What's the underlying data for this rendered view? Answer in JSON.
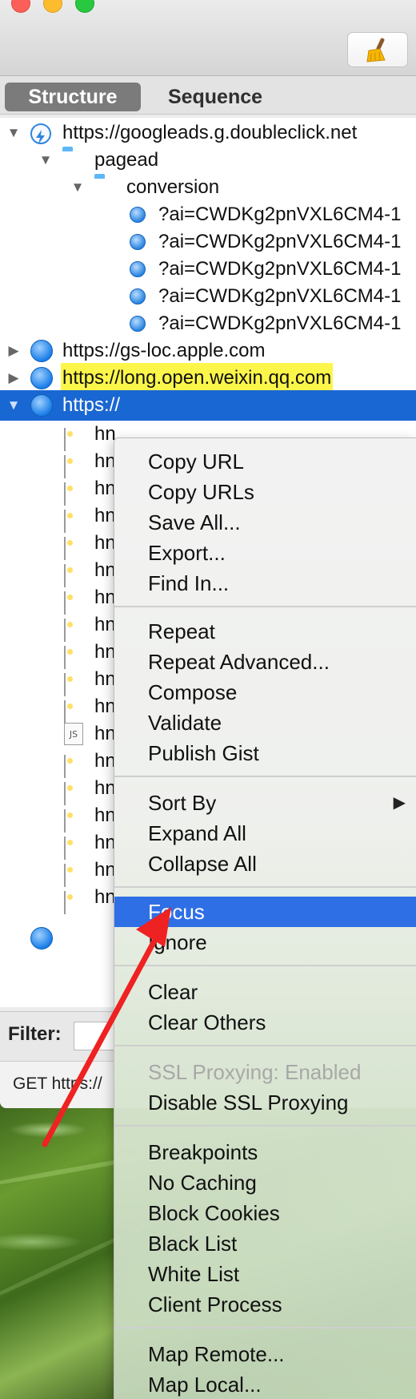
{
  "toolbar": {
    "clear_icon": "broom-icon"
  },
  "tabs": [
    {
      "label": "Structure",
      "active": true
    },
    {
      "label": "Sequence",
      "active": false
    }
  ],
  "tree": {
    "host1": "https://googleads.g.doubleclick.net",
    "folder1": "pagead",
    "folder2": "conversion",
    "requests": [
      "?ai=CWDKg2pnVXL6CM4-1",
      "?ai=CWDKg2pnVXL6CM4-1",
      "?ai=CWDKg2pnVXL6CM4-1",
      "?ai=CWDKg2pnVXL6CM4-1",
      "?ai=CWDKg2pnVXL6CM4-1"
    ],
    "host2": "https://gs-loc.apple.com",
    "host3": "https://long.open.weixin.qq.com",
    "host4_partial": "https://",
    "child_prefix": "hn"
  },
  "filter": {
    "label": "Filter:"
  },
  "status": {
    "text": "GET https://"
  },
  "context_menu": {
    "group1": [
      "Copy URL",
      "Copy URLs",
      "Save All...",
      "Export...",
      "Find In..."
    ],
    "group2": [
      "Repeat",
      "Repeat Advanced...",
      "Compose",
      "Validate",
      "Publish Gist"
    ],
    "group3": [
      "Sort By",
      "Expand All",
      "Collapse All"
    ],
    "group4": [
      "Focus",
      "Ignore"
    ],
    "group5": [
      "Clear",
      "Clear Others"
    ],
    "group6": [
      "SSL Proxying: Enabled",
      "Disable SSL Proxying"
    ],
    "group7": [
      "Breakpoints",
      "No Caching",
      "Block Cookies",
      "Black List",
      "White List",
      "Client Process"
    ],
    "group8": [
      "Map Remote...",
      "Map Local..."
    ],
    "highlighted": "Focus",
    "disabled": "SSL Proxying: Enabled",
    "submenu_arrow": "▶"
  },
  "annotation": {
    "color": "#ee2222"
  }
}
